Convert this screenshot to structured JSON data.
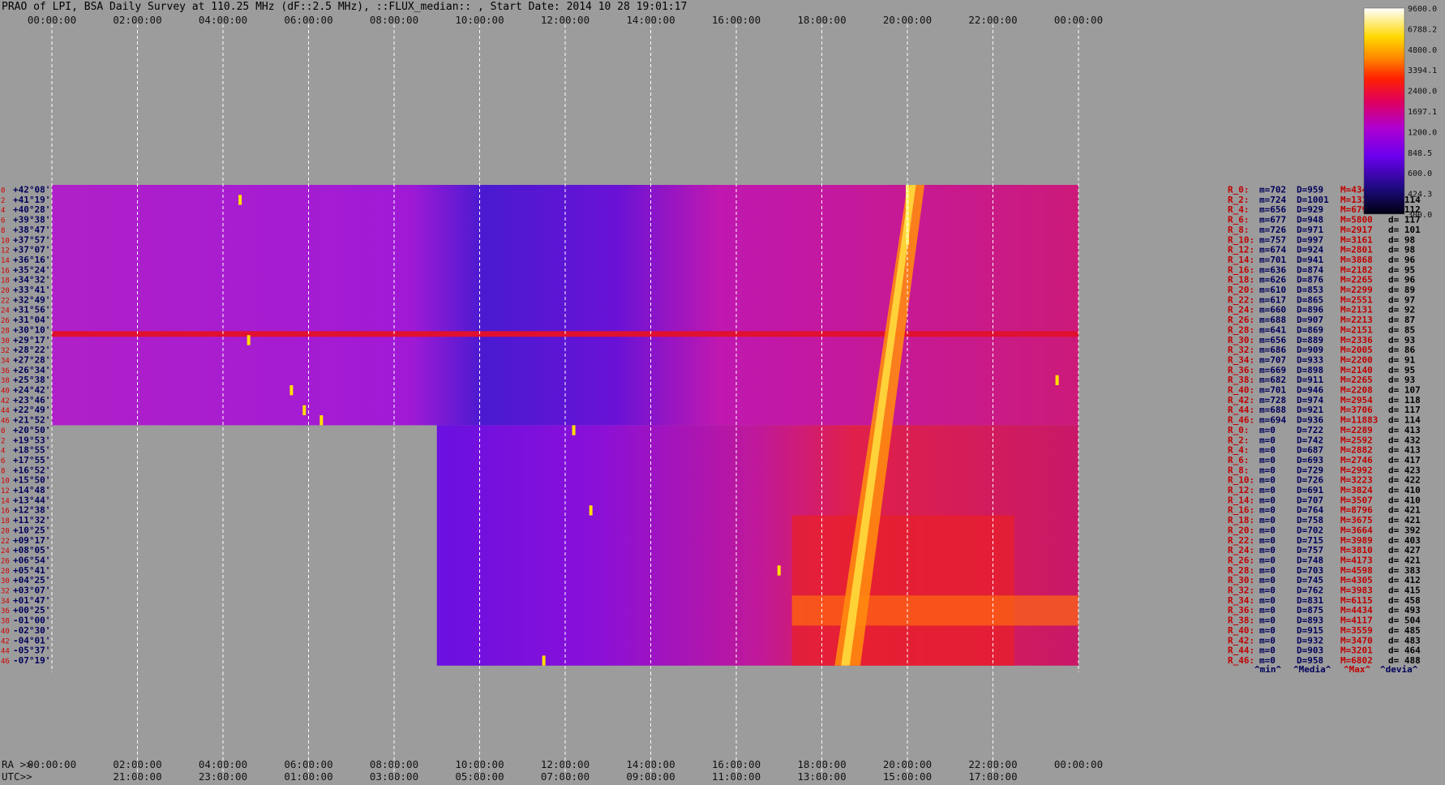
{
  "title": "PRAO of LPI, BSA Daily Survey at 110.25 MHz (dF::2.5 MHz), ::FLUX_median:: , Start Date: 2014 10 28 19:01:17",
  "colors": {
    "background": "#9c9c9c",
    "grid": "#ffffff",
    "row_label": "#d00000",
    "dec_label": "#00005a",
    "stat_max": "#c00000"
  },
  "chart_data": {
    "type": "heatmap",
    "title": "PRAO of LPI, BSA Daily Survey at 110.25 MHz (dF::2.5 MHz), ::FLUX_median:: , Start Date: 2014 10 28 19:01:17",
    "colormap": "black-blue-purple-red-orange-yellow-white",
    "colorbar_ticks": [
      "9600.0",
      "6788.2",
      "4800.0",
      "3394.1",
      "2400.0",
      "1697.1",
      "1200.0",
      "848.5",
      "600.0",
      "424.3",
      "300.0"
    ],
    "x_label_ra": "RA >>",
    "x_label_utc": "UTC>>",
    "x_ticks_top": [
      "00:00:00",
      "02:00:00",
      "04:00:00",
      "06:00:00",
      "08:00:00",
      "10:00:00",
      "12:00:00",
      "14:00:00",
      "16:00:00",
      "18:00:00",
      "20:00:00",
      "22:00:00",
      "00:00:00"
    ],
    "x_ticks_ra_bottom": [
      "00:00:00",
      "02:00:00",
      "04:00:00",
      "06:00:00",
      "08:00:00",
      "10:00:00",
      "12:00:00",
      "14:00:00",
      "16:00:00",
      "18:00:00",
      "20:00:00",
      "22:00:00",
      "00:00:00"
    ],
    "x_ticks_utc_bottom": [
      "21:00:00",
      "23:00:00",
      "01:00:00",
      "03:00:00",
      "05:00:00",
      "07:00:00",
      "09:00:00",
      "11:00:00",
      "13:00:00",
      "15:00:00",
      "17:00:00"
    ],
    "dec_labels": [
      "+42°08'",
      "+41°19'",
      "+40°28'",
      "+39°38'",
      "+38°47'",
      "+37°57'",
      "+37°07'",
      "+36°16'",
      "+35°24'",
      "+34°32'",
      "+33°41'",
      "+32°49'",
      "+31°56'",
      "+31°04'",
      "+30°10'",
      "+29°17'",
      "+28°22'",
      "+27°28'",
      "+26°34'",
      "+25°38'",
      "+24°42'",
      "+23°46'",
      "+22°49'",
      "+21°52'",
      "+20°50'",
      "+19°53'",
      "+18°55'",
      "+17°55'",
      "+16°52'",
      "+15°50'",
      "+14°48'",
      "+13°44'",
      "+12°38'",
      "+11°32'",
      "+10°25'",
      "+09°17'",
      "+08°05'",
      "+06°54'",
      "+05°41'",
      "+04°25'",
      "+03°07'",
      "+01°47'",
      "+00°25'",
      "-01°00'",
      "-02°30'",
      "-04°01'",
      "-05°37'",
      "-07°19'"
    ],
    "stat_legend": [
      "^min^",
      "^Media^",
      "^Max^",
      "^devia^"
    ],
    "stats": [
      {
        "label": "R_0:",
        "m": "m=702",
        "D": "D=959",
        "M": "M=4346",
        "d": ""
      },
      {
        "label": "R_2:",
        "m": "m=724",
        "D": "D=1001",
        "M": "M=13117",
        "d": "d= 114"
      },
      {
        "label": "R_4:",
        "m": "m=656",
        "D": "D=929",
        "M": "M=67903",
        "d": "d= 112"
      },
      {
        "label": "R_6:",
        "m": "m=677",
        "D": "D=948",
        "M": "M=5800",
        "d": "d= 117"
      },
      {
        "label": "R_8:",
        "m": "m=726",
        "D": "D=971",
        "M": "M=2917",
        "d": "d= 101"
      },
      {
        "label": "R_10:",
        "m": "m=757",
        "D": "D=997",
        "M": "M=3161",
        "d": "d= 98"
      },
      {
        "label": "R_12:",
        "m": "m=674",
        "D": "D=924",
        "M": "M=2801",
        "d": "d= 98"
      },
      {
        "label": "R_14:",
        "m": "m=701",
        "D": "D=941",
        "M": "M=3868",
        "d": "d= 96"
      },
      {
        "label": "R_16:",
        "m": "m=636",
        "D": "D=874",
        "M": "M=2182",
        "d": "d= 95"
      },
      {
        "label": "R_18:",
        "m": "m=626",
        "D": "D=876",
        "M": "M=2265",
        "d": "d= 96"
      },
      {
        "label": "R_20:",
        "m": "m=610",
        "D": "D=853",
        "M": "M=2299",
        "d": "d= 89"
      },
      {
        "label": "R_22:",
        "m": "m=617",
        "D": "D=865",
        "M": "M=2551",
        "d": "d= 97"
      },
      {
        "label": "R_24:",
        "m": "m=660",
        "D": "D=896",
        "M": "M=2131",
        "d": "d= 92"
      },
      {
        "label": "R_26:",
        "m": "m=688",
        "D": "D=907",
        "M": "M=2213",
        "d": "d= 87"
      },
      {
        "label": "R_28:",
        "m": "m=641",
        "D": "D=869",
        "M": "M=2151",
        "d": "d= 85"
      },
      {
        "label": "R_30:",
        "m": "m=656",
        "D": "D=889",
        "M": "M=2336",
        "d": "d= 93"
      },
      {
        "label": "R_32:",
        "m": "m=686",
        "D": "D=909",
        "M": "M=2005",
        "d": "d= 86"
      },
      {
        "label": "R_34:",
        "m": "m=707",
        "D": "D=933",
        "M": "M=2200",
        "d": "d= 91"
      },
      {
        "label": "R_36:",
        "m": "m=669",
        "D": "D=898",
        "M": "M=2140",
        "d": "d= 95"
      },
      {
        "label": "R_38:",
        "m": "m=682",
        "D": "D=911",
        "M": "M=2265",
        "d": "d= 93"
      },
      {
        "label": "R_40:",
        "m": "m=701",
        "D": "D=946",
        "M": "M=2208",
        "d": "d= 107"
      },
      {
        "label": "R_42:",
        "m": "m=728",
        "D": "D=974",
        "M": "M=2954",
        "d": "d= 118"
      },
      {
        "label": "R_44:",
        "m": "m=688",
        "D": "D=921",
        "M": "M=3706",
        "d": "d= 117"
      },
      {
        "label": "R_46:",
        "m": "m=694",
        "D": "D=936",
        "M": "M=11883",
        "d": "d= 114"
      },
      {
        "label": "R_0:",
        "m": "m=0",
        "D": "D=722",
        "M": "M=2289",
        "d": "d= 413"
      },
      {
        "label": "R_2:",
        "m": "m=0",
        "D": "D=742",
        "M": "M=2592",
        "d": "d= 432"
      },
      {
        "label": "R_4:",
        "m": "m=0",
        "D": "D=687",
        "M": "M=2882",
        "d": "d= 413"
      },
      {
        "label": "R_6:",
        "m": "m=0",
        "D": "D=693",
        "M": "M=2746",
        "d": "d= 417"
      },
      {
        "label": "R_8:",
        "m": "m=0",
        "D": "D=729",
        "M": "M=2992",
        "d": "d= 423"
      },
      {
        "label": "R_10:",
        "m": "m=0",
        "D": "D=726",
        "M": "M=3223",
        "d": "d= 422"
      },
      {
        "label": "R_12:",
        "m": "m=0",
        "D": "D=691",
        "M": "M=3824",
        "d": "d= 410"
      },
      {
        "label": "R_14:",
        "m": "m=0",
        "D": "D=707",
        "M": "M=3507",
        "d": "d= 410"
      },
      {
        "label": "R_16:",
        "m": "m=0",
        "D": "D=764",
        "M": "M=8796",
        "d": "d= 421"
      },
      {
        "label": "R_18:",
        "m": "m=0",
        "D": "D=758",
        "M": "M=3675",
        "d": "d= 421"
      },
      {
        "label": "R_20:",
        "m": "m=0",
        "D": "D=702",
        "M": "M=3664",
        "d": "d= 392"
      },
      {
        "label": "R_22:",
        "m": "m=0",
        "D": "D=715",
        "M": "M=3989",
        "d": "d= 403"
      },
      {
        "label": "R_24:",
        "m": "m=0",
        "D": "D=757",
        "M": "M=3810",
        "d": "d= 427"
      },
      {
        "label": "R_26:",
        "m": "m=0",
        "D": "D=748",
        "M": "M=4173",
        "d": "d= 421"
      },
      {
        "label": "R_28:",
        "m": "m=0",
        "D": "D=703",
        "M": "M=4598",
        "d": "d= 383"
      },
      {
        "label": "R_30:",
        "m": "m=0",
        "D": "D=745",
        "M": "M=4305",
        "d": "d= 412"
      },
      {
        "label": "R_32:",
        "m": "m=0",
        "D": "D=762",
        "M": "M=3983",
        "d": "d= 415"
      },
      {
        "label": "R_34:",
        "m": "m=0",
        "D": "D=831",
        "M": "M=6115",
        "d": "d= 458"
      },
      {
        "label": "R_36:",
        "m": "m=0",
        "D": "D=875",
        "M": "M=4434",
        "d": "d= 493"
      },
      {
        "label": "R_38:",
        "m": "m=0",
        "D": "D=893",
        "M": "M=4117",
        "d": "d= 504"
      },
      {
        "label": "R_40:",
        "m": "m=0",
        "D": "D=915",
        "M": "M=3559",
        "d": "d= 485"
      },
      {
        "label": "R_42:",
        "m": "m=0",
        "D": "D=932",
        "M": "M=3470",
        "d": "d= 483"
      },
      {
        "label": "R_44:",
        "m": "m=0",
        "D": "D=903",
        "M": "M=3201",
        "d": "d= 464"
      },
      {
        "label": "R_46:",
        "m": "m=0",
        "D": "D=958",
        "M": "M=6802",
        "d": "d= 488"
      }
    ]
  }
}
